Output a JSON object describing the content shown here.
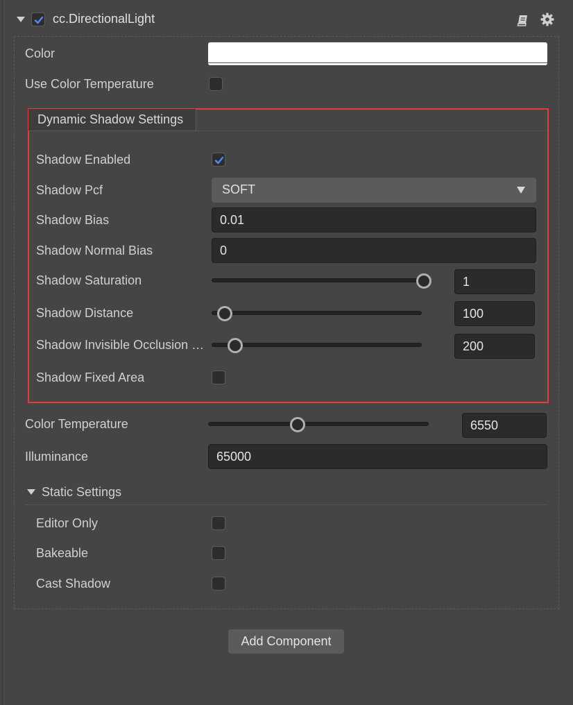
{
  "component": {
    "title": "cc.DirectionalLight",
    "enabled": true
  },
  "properties": {
    "color_label": "Color",
    "color_value": "#ffffff",
    "use_color_temperature_label": "Use Color Temperature",
    "use_color_temperature": false,
    "color_temperature_label": "Color Temperature",
    "color_temperature_value": "6550",
    "illuminance_label": "Illuminance",
    "illuminance_value": "65000"
  },
  "dynamic_shadow": {
    "tab_label": "Dynamic Shadow Settings",
    "shadow_enabled_label": "Shadow Enabled",
    "shadow_enabled": true,
    "shadow_pcf_label": "Shadow Pcf",
    "shadow_pcf_value": "SOFT",
    "shadow_bias_label": "Shadow Bias",
    "shadow_bias_value": "0.01",
    "shadow_normal_bias_label": "Shadow Normal Bias",
    "shadow_normal_bias_value": "0",
    "shadow_saturation_label": "Shadow Saturation",
    "shadow_saturation_value": "1",
    "shadow_distance_label": "Shadow Distance",
    "shadow_distance_value": "100",
    "shadow_invisible_occlusion_label": "Shadow Invisible Occlusion …",
    "shadow_invisible_occlusion_value": "200",
    "shadow_fixed_area_label": "Shadow Fixed Area",
    "shadow_fixed_area": false
  },
  "static_settings": {
    "header": "Static Settings",
    "editor_only_label": "Editor Only",
    "bakeable_label": "Bakeable",
    "cast_shadow_label": "Cast Shadow"
  },
  "footer": {
    "add_component_label": "Add Component"
  },
  "colors": {
    "highlight": "#e8393b",
    "check_accent": "#4d8cf5",
    "panel_bg": "#454545"
  }
}
